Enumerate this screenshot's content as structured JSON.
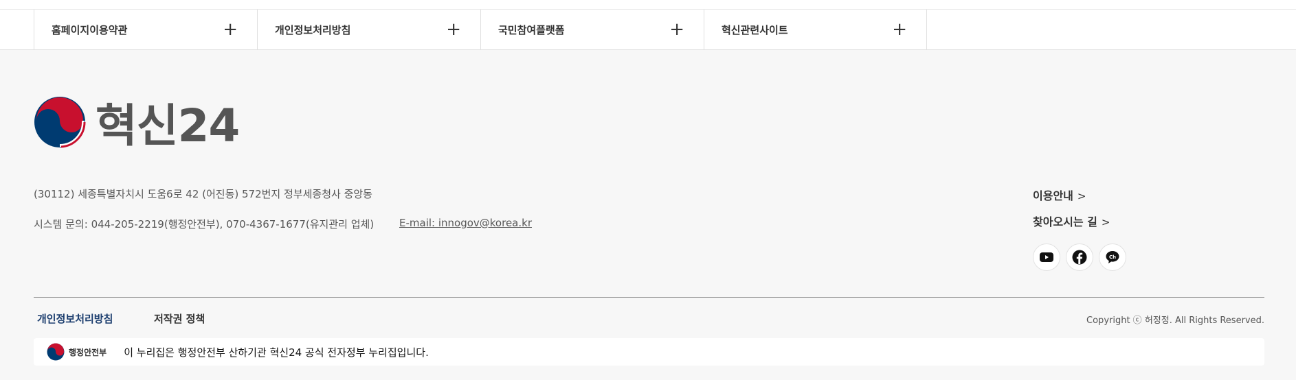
{
  "top_menu": [
    {
      "label": "홈페이지이용약관"
    },
    {
      "label": "개인정보처리방침"
    },
    {
      "label": "국민참여플랫폼"
    },
    {
      "label": "혁신관련사이트"
    }
  ],
  "logo": {
    "text": "혁신24"
  },
  "footer": {
    "address": "(30112) 세종특별자치시 도움6로 42 (어진동) 572번지 정부세종청사 중앙동",
    "contact": "시스템 문의: 044-205-2219(행정안전부), 070-4367-1677(유지관리 업체)",
    "email": "E-mail: innogov@korea.kr"
  },
  "right_links": [
    {
      "label": "이용안내"
    },
    {
      "label": "찾아오시는 길"
    }
  ],
  "social": [
    "youtube-icon",
    "facebook-icon",
    "kakao-channel-icon"
  ],
  "bottom_links": [
    {
      "label": "개인정보처리방침",
      "color": "#1b3d6e"
    },
    {
      "label": "저작권 정책",
      "color": "#333333"
    }
  ],
  "copyright": "Copyright ⓒ 허정정. All Rights Reserved.",
  "gov_bar": {
    "org_name": "행정안전부",
    "text": "이 누리집은 행정안전부 산하기관 혁신24 공식 전자정부 누리집입니다."
  },
  "colors": {
    "brand_red": "#c8102e",
    "brand_blue": "#003b71",
    "accent_navy": "#1b3d6e"
  }
}
